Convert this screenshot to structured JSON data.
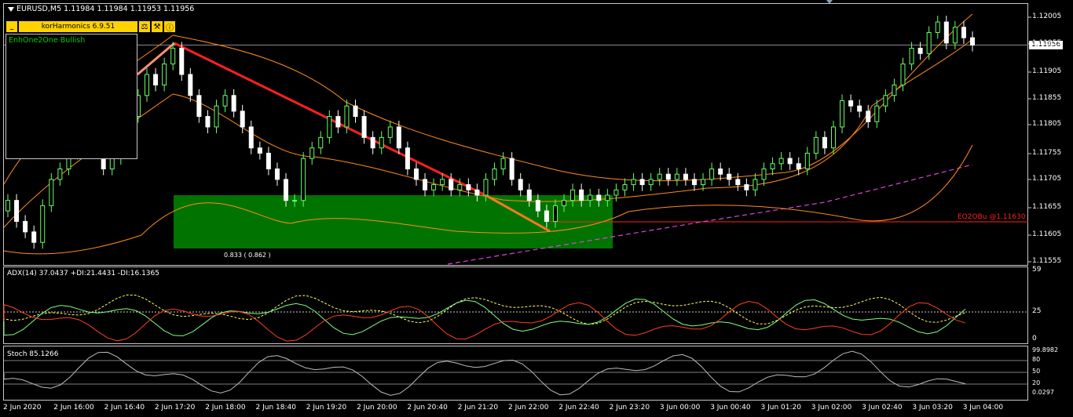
{
  "chart_title": "EURUSD,M5  1.11984 1.11984 1.11953 1.11956",
  "toolbar": {
    "min_label": "_",
    "title": "korHarmonics 6.9.51",
    "icon_settings": "⚖",
    "icon_tools": "⚒",
    "icon_info": "ⓘ"
  },
  "info_box": {
    "text": "EnhOne2One Bullish"
  },
  "pattern": {
    "label": "EO2OBu   @1.11630",
    "ratio": "0.833 ( 0.862 )"
  },
  "current_price": "1.11956",
  "price_axis": [
    "1.12005",
    "1.11955",
    "1.11905",
    "1.11855",
    "1.11805",
    "1.11755",
    "1.11705",
    "1.11655",
    "1.11605",
    "1.11555"
  ],
  "adx": {
    "title": "ADX(14) 37.0437 +DI:21.4431 -DI:16.1365",
    "axis": [
      "59",
      "25",
      "0"
    ]
  },
  "stoch": {
    "title": "Stoch 85.1266",
    "axis": [
      "99.8982",
      "80",
      "50",
      "20",
      "0.0297"
    ]
  },
  "time_axis": [
    "2 Jun 2020",
    "2 Jun 16:00",
    "2 Jun 16:40",
    "2 Jun 17:20",
    "2 Jun 18:00",
    "2 Jun 18:40",
    "2 Jun 19:20",
    "2 Jun 20:00",
    "2 Jun 20:40",
    "2 Jun 21:20",
    "2 Jun 22:00",
    "2 Jun 22:40",
    "2 Jun 23:20",
    "3 Jun 00:00",
    "3 Jun 00:40",
    "3 Jun 01:20",
    "3 Jun 02:00",
    "3 Jun 02:40",
    "3 Jun 03:20",
    "3 Jun 04:00"
  ],
  "colors": {
    "bull": "#66ff66",
    "bear": "#ffffff",
    "band": "#ff8c1a",
    "harmonic": "#ff2020",
    "zone": "#008000",
    "ma": "#e040e0"
  },
  "chart_data": {
    "type": "candlestick",
    "symbol": "EURUSD",
    "timeframe": "M5",
    "ylim": [
      1.1154,
      1.1203
    ],
    "close": [
      1.1166,
      1.1162,
      1.116,
      1.1158,
      1.1165,
      1.117,
      1.1172,
      1.1175,
      1.1178,
      1.118,
      1.1176,
      1.1172,
      1.1174,
      1.1178,
      1.1182,
      1.1186,
      1.119,
      1.1188,
      1.1192,
      1.1195,
      1.119,
      1.1186,
      1.1182,
      1.118,
      1.1184,
      1.1186,
      1.1183,
      1.118,
      1.1176,
      1.1175,
      1.1172,
      1.117,
      1.1166,
      1.1166,
      1.1174,
      1.1176,
      1.1178,
      1.1182,
      1.118,
      1.1184,
      1.1182,
      1.1178,
      1.1176,
      1.1178,
      1.118,
      1.1176,
      1.1172,
      1.117,
      1.1168,
      1.1169,
      1.117,
      1.1168,
      1.1169,
      1.1168,
      1.1167,
      1.117,
      1.1172,
      1.1174,
      1.117,
      1.1168,
      1.1166,
      1.1164,
      1.1162,
      1.1165,
      1.1166,
      1.1168,
      1.1166,
      1.1167,
      1.1166,
      1.1167,
      1.1168,
      1.1169,
      1.117,
      1.1169,
      1.117,
      1.1171,
      1.117,
      1.1171,
      1.117,
      1.1169,
      1.117,
      1.1172,
      1.1171,
      1.117,
      1.1169,
      1.1168,
      1.117,
      1.1172,
      1.1173,
      1.1174,
      1.1173,
      1.1172,
      1.1175,
      1.1178,
      1.1176,
      1.118,
      1.1185,
      1.1184,
      1.1183,
      1.1181,
      1.1184,
      1.1186,
      1.1188,
      1.1192,
      1.1195,
      1.1194,
      1.1198,
      1.12,
      1.1196,
      1.1199,
      1.1197,
      1.11956
    ]
  }
}
